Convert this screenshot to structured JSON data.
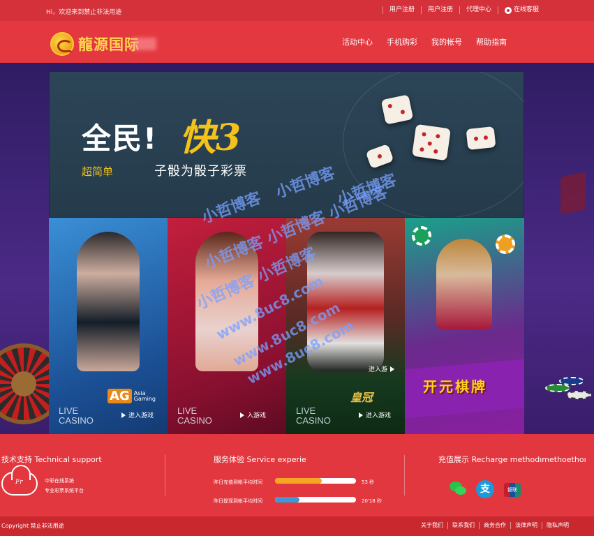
{
  "topbar": {
    "welcome": "Hi，欢迎来到禁止非法用途",
    "links": [
      "用户注册",
      "用户注册",
      "代理中心"
    ],
    "service": "在线客服"
  },
  "header": {
    "logo_text": "龍源国际",
    "nav": [
      "活动中心",
      "手机购彩",
      "我的帐号",
      "帮助指南"
    ]
  },
  "banner": {
    "headline_white": "全民!",
    "headline_gold": "快3",
    "tagline": "超简单",
    "subline": "子骰为骰子彩票"
  },
  "tiles": [
    {
      "live": "LIVE",
      "casino": "CASINO",
      "enter": "进入游戏",
      "brand_mark": "AG",
      "brand_sub1": "Asia",
      "brand_sub2": "Gaming"
    },
    {
      "live": "LIVE",
      "casino": "CASINO",
      "enter": "入游戏"
    },
    {
      "live": "LIVE",
      "casino": "CASINO",
      "enter": "进入游戏",
      "enter_top": "进入游",
      "brand": "皇冠"
    },
    {
      "title": "开元棋牌"
    }
  ],
  "watermark": {
    "lines": [
      "小哲博客",
      "小哲博客",
      "小哲博客",
      "小哲博客 小哲博客 小哲博客",
      "小哲博客 小哲博客",
      "www.8uc8.com",
      "www.8uc8.com",
      "www.8uc8.com"
    ]
  },
  "info": {
    "support_title": "技术支持 Technical support",
    "cloud_text": "Fr",
    "support_lines": [
      "中彩在线系统",
      "专业彩票系统平台"
    ],
    "service_title": "服务体验 Service experie",
    "rows": [
      {
        "label": "昨日充值到帐平均时间",
        "value": "53 秒",
        "progress": 0.58,
        "color": "#f5a623"
      },
      {
        "label": "昨日提现到帐平均时间",
        "value": "20'18 秒",
        "progress": 0.3,
        "color": "#3a9ad9"
      }
    ],
    "recharge_title": "充值展示 Recharge methodımethoethoı",
    "alipay_glyph": "支",
    "union_text": "银联"
  },
  "footer": {
    "copyright": "Copyright 禁止非法用途",
    "links": [
      "关于我们",
      "联系我们",
      "商务合作",
      "法律声明",
      "隐私声明"
    ]
  }
}
